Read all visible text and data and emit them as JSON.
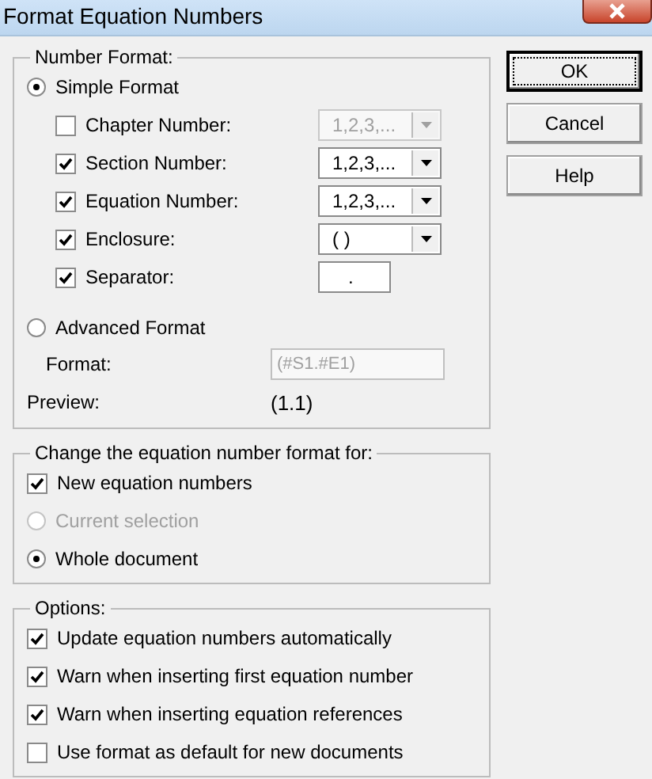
{
  "window": {
    "title": "Format Equation Numbers"
  },
  "number_format": {
    "title": "Number Format:",
    "simple_format": {
      "label": "Simple Format",
      "selected": true
    },
    "fields": [
      {
        "kind": "dropdown",
        "label": "Chapter Number:",
        "checked": false,
        "value": "1,2,3,...",
        "disabled": true
      },
      {
        "kind": "dropdown",
        "label": "Section Number:",
        "checked": true,
        "value": "1,2,3,...",
        "disabled": false
      },
      {
        "kind": "dropdown",
        "label": "Equation Number:",
        "checked": true,
        "value": "1,2,3,...",
        "disabled": false
      },
      {
        "kind": "dropdown",
        "label": "Enclosure:",
        "checked": true,
        "value": "( )",
        "disabled": false
      },
      {
        "kind": "text",
        "label": "Separator:",
        "checked": true,
        "value": ".",
        "disabled": false
      }
    ],
    "advanced_format": {
      "label": "Advanced Format",
      "selected": false
    },
    "format": {
      "label": "Format:",
      "value": "(#S1.#E1)",
      "disabled": true
    },
    "preview": {
      "label": "Preview:",
      "value": "(1.1)"
    }
  },
  "scope": {
    "title": "Change the equation number format for:",
    "items": [
      {
        "kind": "checkbox",
        "label": "New equation numbers",
        "checked": true,
        "disabled": false
      },
      {
        "kind": "radio",
        "label": "Current selection",
        "selected": false,
        "disabled": true
      },
      {
        "kind": "radio",
        "label": "Whole document",
        "selected": true,
        "disabled": false
      }
    ]
  },
  "options": {
    "title": "Options:",
    "items": [
      {
        "label": "Update equation numbers automatically",
        "checked": true
      },
      {
        "label": "Warn when inserting first equation number",
        "checked": true
      },
      {
        "label": "Warn when inserting equation references",
        "checked": true
      },
      {
        "label": "Use format as default for new documents",
        "checked": false
      }
    ]
  },
  "buttons": [
    {
      "label": "OK",
      "default": true
    },
    {
      "label": "Cancel",
      "default": false
    },
    {
      "label": "Help",
      "default": false
    }
  ]
}
